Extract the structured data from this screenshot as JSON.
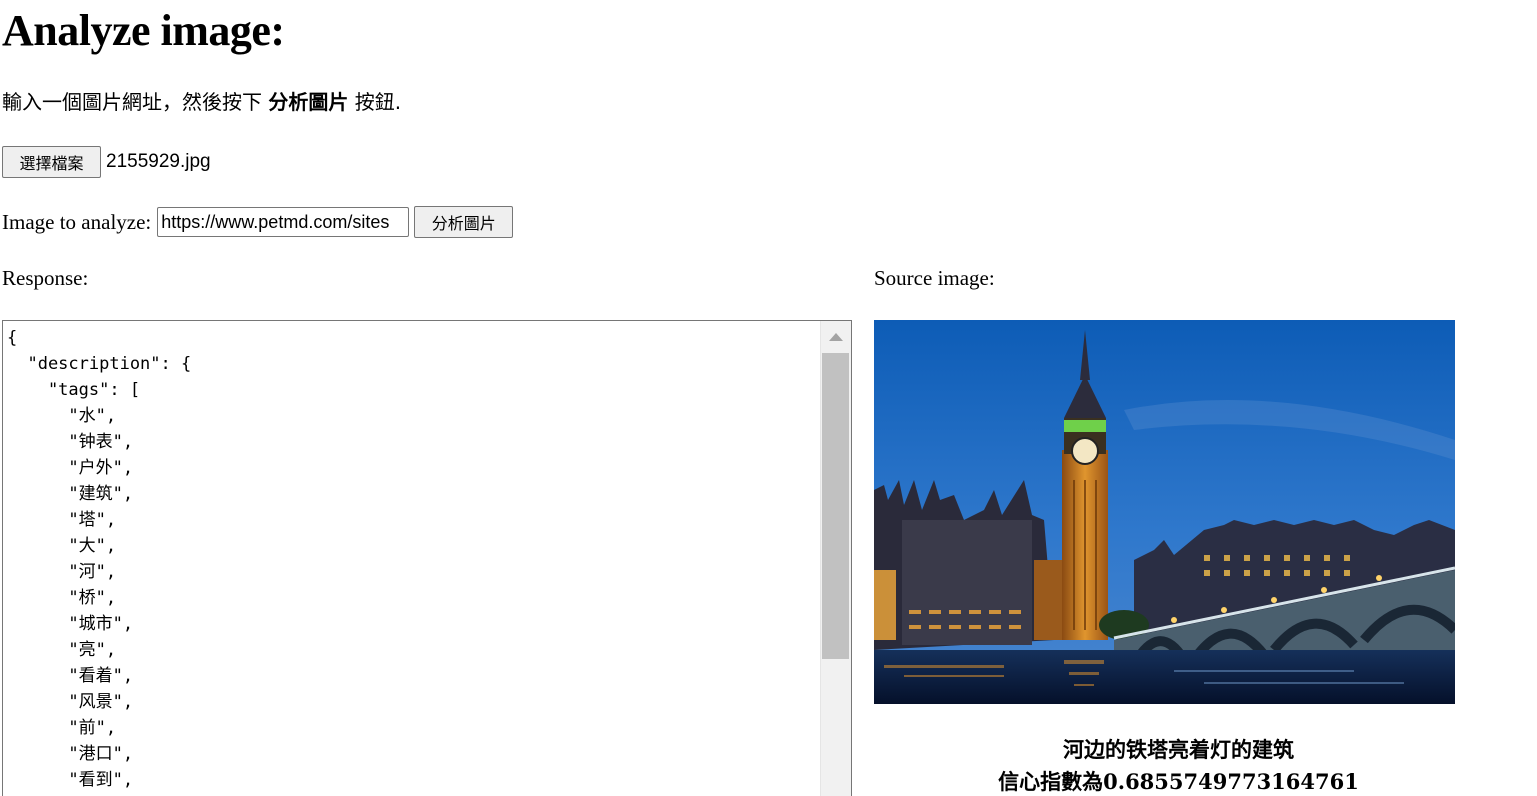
{
  "heading": "Analyze image:",
  "instructions": {
    "prefix": "輸入一個圖片網址，然後按下 ",
    "button_name": "分析圖片",
    "suffix": " 按鈕."
  },
  "file_picker": {
    "button_label": "選擇檔案",
    "file_name": "2155929.jpg"
  },
  "url_form": {
    "label": "Image to analyze:",
    "input_value": "https://www.petmd.com/sites",
    "submit_label": "分析圖片"
  },
  "response": {
    "label": "Response:",
    "json_text": "{\n  \"description\": {\n    \"tags\": [\n      \"水\",\n      \"钟表\",\n      \"户外\",\n      \"建筑\",\n      \"塔\",\n      \"大\",\n      \"河\",\n      \"桥\",\n      \"城市\",\n      \"亮\",\n      \"看着\",\n      \"风景\",\n      \"前\",\n      \"港口\",\n      \"看到\",\n      \"阳天\","
  },
  "source": {
    "label": "Source image:",
    "caption_line1": "河边的铁塔亮着灯的建筑",
    "caption_line2": "信心指數為0.6855749773164761"
  },
  "icons": {
    "scroll_up": "triangle-up-icon"
  },
  "colors": {
    "sky_top": "#0e5fb8",
    "sky_bottom": "#3b7fcf",
    "tower_light": "#d08a2a",
    "water": "#0a1a3a"
  }
}
